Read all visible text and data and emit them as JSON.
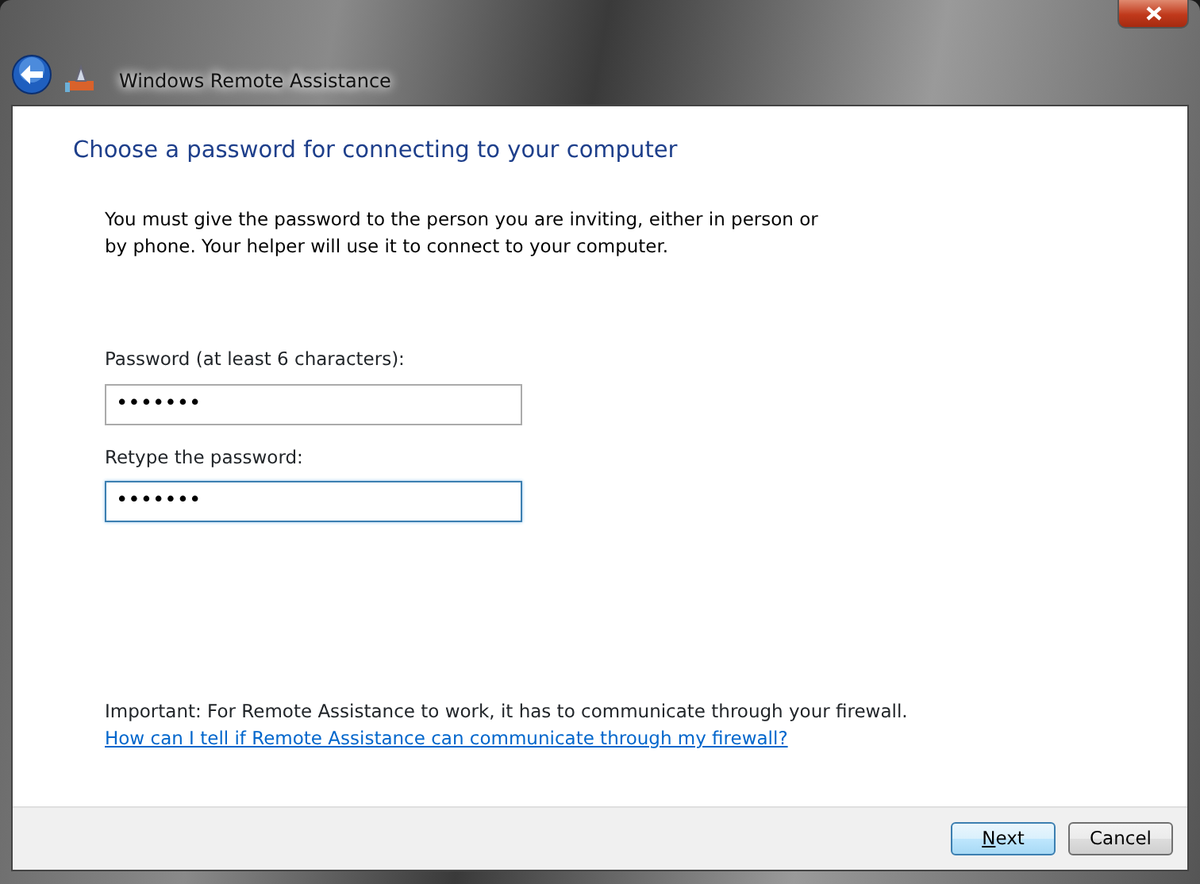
{
  "window": {
    "title": "Windows Remote Assistance"
  },
  "heading": "Choose a password for connecting to your computer",
  "description": "You must give the password to the person you are inviting, either in person or by phone. Your helper will use it to connect to your computer.",
  "fields": [
    {
      "label": "Password (at least 6 characters):",
      "value": "•••••••",
      "focused": false
    },
    {
      "label": "Retype the password:",
      "value": "•••••••",
      "focused": true
    }
  ],
  "note": "Important: For Remote Assistance to work, it has to communicate through your firewall.",
  "help_link": "How can I tell if Remote Assistance can communicate through my firewall?",
  "buttons": [
    {
      "label": "Next",
      "default": true,
      "mnemonic_underlined": true
    },
    {
      "label": "Cancel",
      "default": false
    }
  ]
}
